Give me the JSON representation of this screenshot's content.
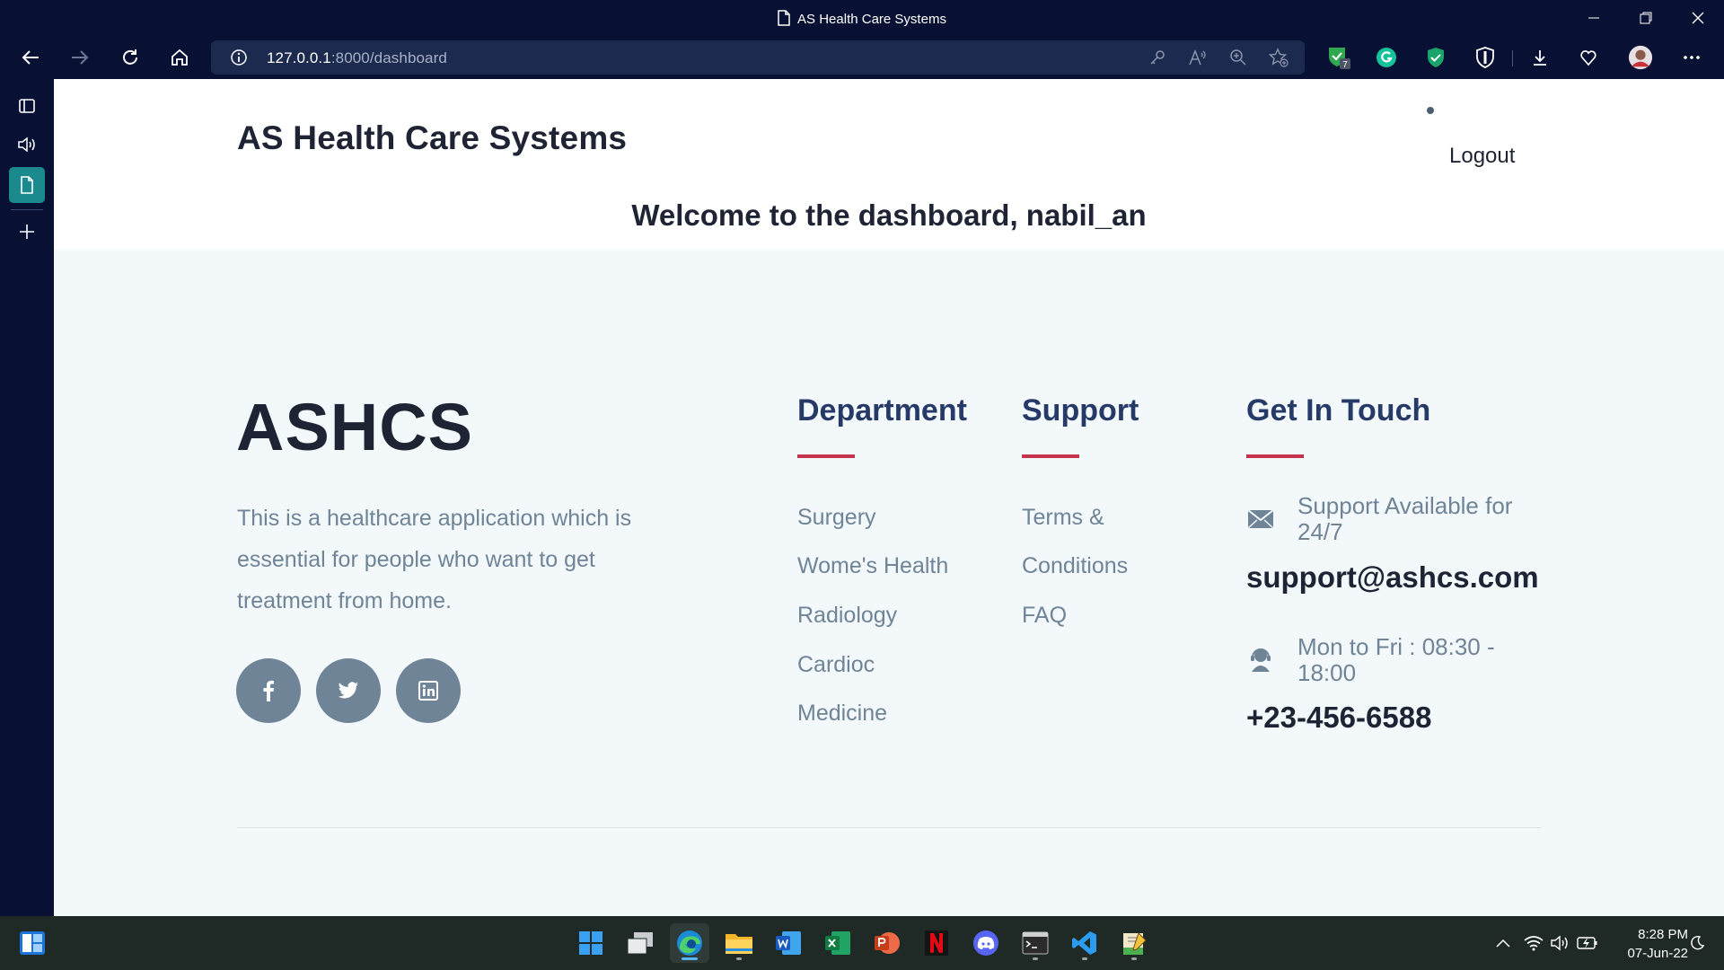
{
  "browser": {
    "tab_title": "AS Health Care Systems",
    "url_host": "127.0.0.1",
    "url_rest": ":8000/dashboard",
    "extension_badge": "7"
  },
  "site": {
    "brand": "AS Health Care Systems",
    "logout_label": "Logout",
    "welcome": "Welcome to the dashboard, nabil_an"
  },
  "footer": {
    "logo": "ASHCS",
    "description": "This is a healthcare application which is essential for people who want to get treatment from home.",
    "social": [
      {
        "icon": "facebook-icon"
      },
      {
        "icon": "twitter-icon"
      },
      {
        "icon": "linkedin-icon"
      }
    ],
    "department": {
      "title": "Department",
      "links": [
        "Surgery",
        "Wome's Health",
        "Radiology",
        "Cardioc",
        "Medicine"
      ]
    },
    "support": {
      "title": "Support",
      "links": [
        "Terms &",
        "Conditions",
        "FAQ"
      ]
    },
    "contact": {
      "title": "Get In Touch",
      "email_note": "Support Available for 24/7",
      "email": "support@ashcs.com",
      "hours_note": "Mon to Fri : 08:30 - 18:00",
      "phone": "+23-456-6588"
    },
    "accent_color": "#c5344c",
    "heading_color": "#263a68"
  },
  "taskbar": {
    "time": "8:28 PM",
    "date": "07-Jun-22",
    "apps": [
      "start-icon",
      "task-view-icon",
      "edge-icon",
      "file-explorer-icon",
      "word-icon",
      "excel-icon",
      "powerpoint-icon",
      "netflix-icon",
      "discord-icon",
      "terminal-icon",
      "vscode-icon",
      "notepad-icon"
    ]
  }
}
